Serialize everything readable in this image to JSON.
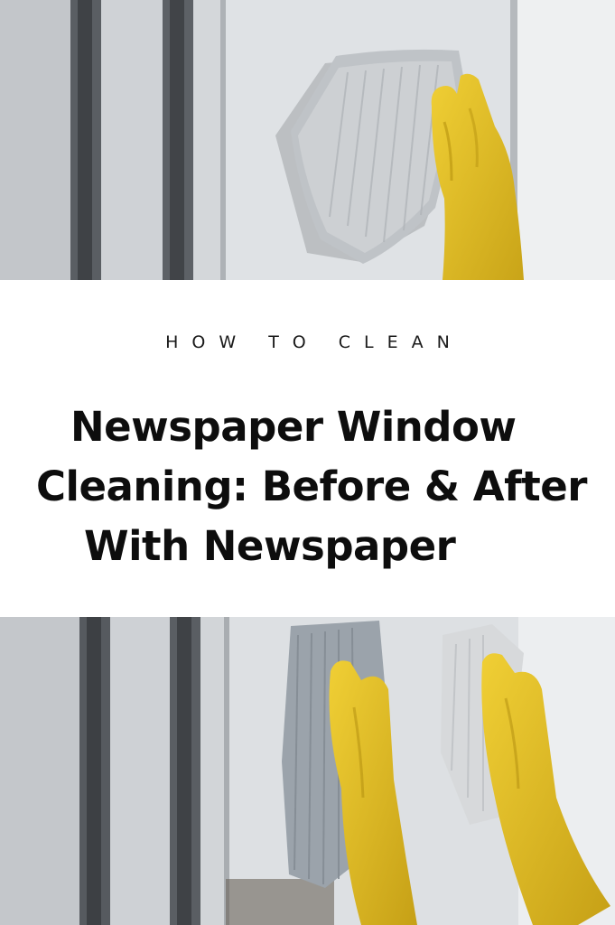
{
  "kicker": "HOW TO CLEAN",
  "headline": {
    "line1": "Newspaper Window",
    "line2": "Cleaning: Before & After",
    "line3": "With Newspaper"
  },
  "photos": {
    "top": "gloved-hand-wiping-window-with-cloth",
    "bottom": "two-gloved-hands-wiping-window-with-cloths"
  },
  "colors": {
    "glove": "#e3bf24",
    "cloth": "#b9bdc2",
    "window_frame": "#cfd3d8",
    "frame_shadow": "#4f5358",
    "title_text": "#0d0d0d"
  }
}
